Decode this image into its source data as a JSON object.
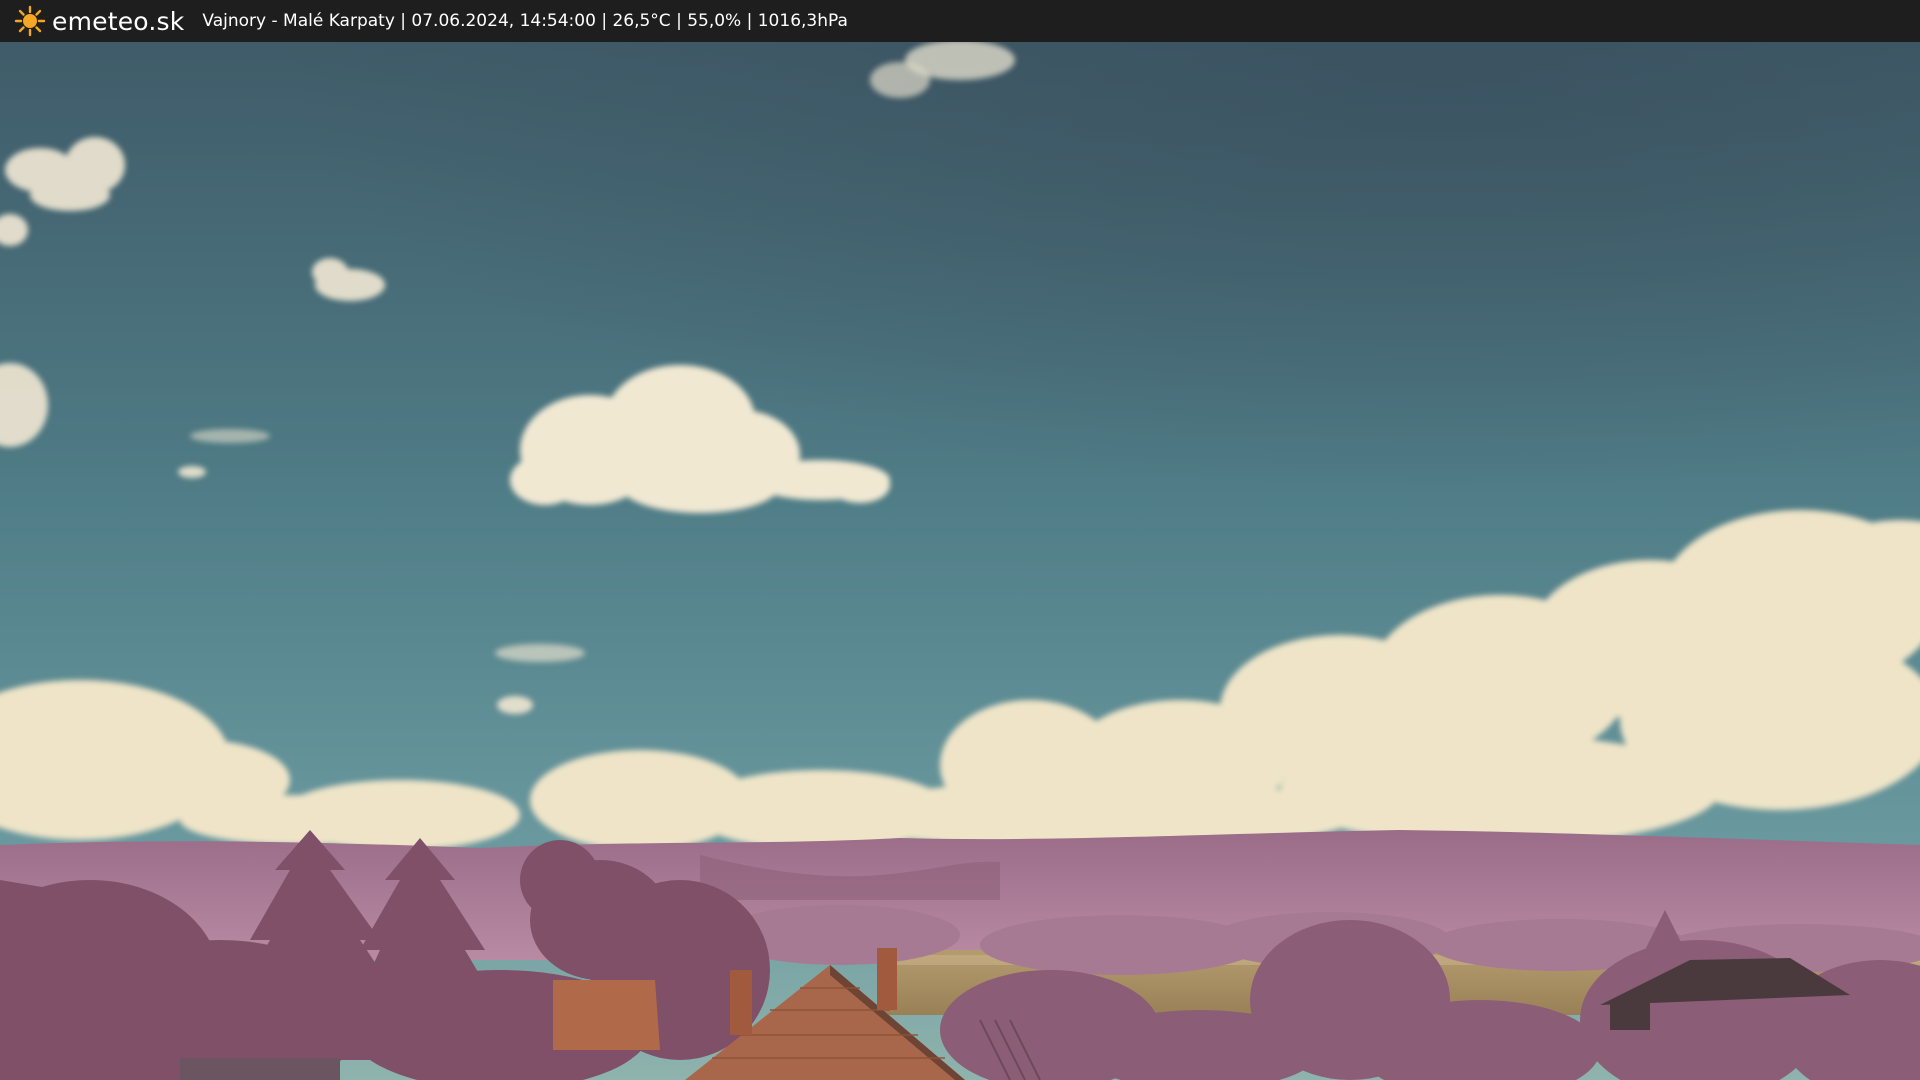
{
  "overlay": {
    "brand": "emeteo.sk",
    "logo_icon": "sun-icon",
    "caption": "Vajnory - Malé Karpaty | 07.06.2024, 14:54:00 | 26,5°C | 55,0% | 1016,3hPa"
  },
  "colors": {
    "bar_background": "#1e1e1e",
    "sun": "#f5a623",
    "sky_top": "#3f5a68",
    "sky_bottom": "#6b9aa0",
    "clouds": "#efe6cf",
    "hills": "#a3738f",
    "trees": "#8a5a73",
    "field": "#a68c60",
    "roof": "#b06a4a"
  }
}
